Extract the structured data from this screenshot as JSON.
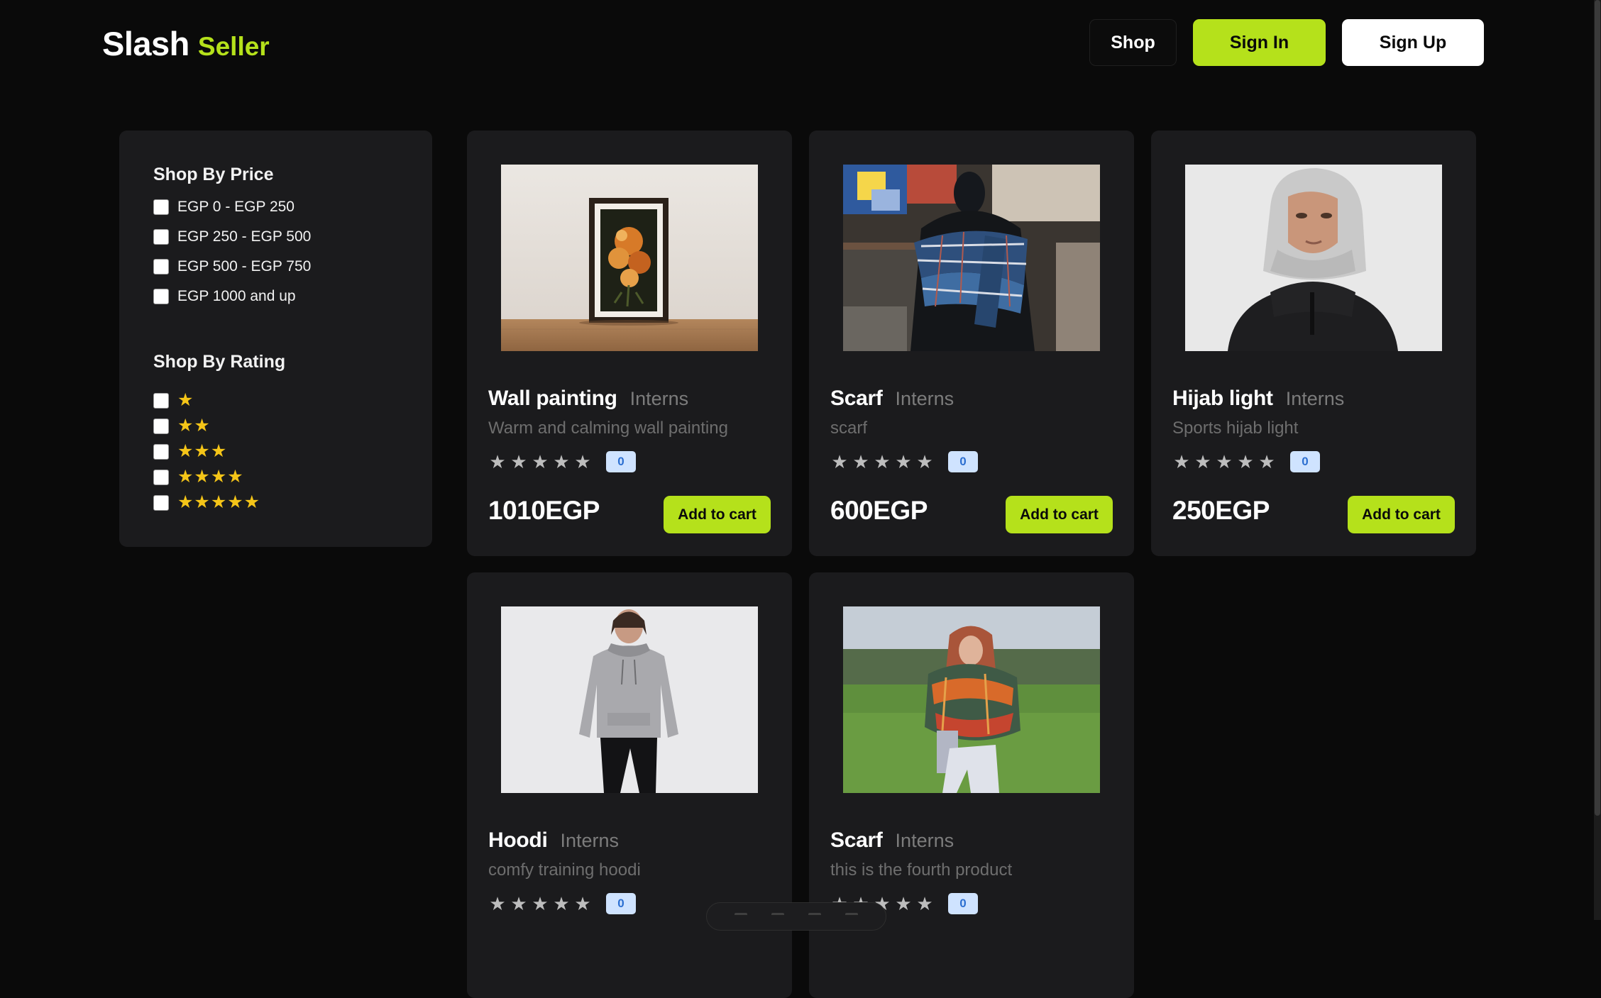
{
  "header": {
    "logo_main": "Slash",
    "logo_accent": "Seller",
    "nav": {
      "shop": "Shop",
      "sign_in": "Sign In",
      "sign_up": "Sign Up"
    }
  },
  "filters": {
    "price_title": "Shop By Price",
    "price_options": [
      "EGP 0 - EGP 250",
      "EGP 250 - EGP 500",
      "EGP 500 - EGP 750",
      "EGP 1000 and up"
    ],
    "rating_title": "Shop By Rating",
    "rating_options": [
      "★",
      "★★",
      "★★★",
      "★★★★",
      "★★★★★"
    ]
  },
  "products": [
    {
      "name": "Wall painting",
      "seller": "Interns",
      "description": "Warm and calming wall painting",
      "rating_count": "0",
      "price": "1010EGP",
      "cart_label": "Add to cart"
    },
    {
      "name": "Scarf",
      "seller": "Interns",
      "description": "scarf",
      "rating_count": "0",
      "price": "600EGP",
      "cart_label": "Add to cart"
    },
    {
      "name": "Hijab light",
      "seller": "Interns",
      "description": "Sports hijab light",
      "rating_count": "0",
      "price": "250EGP",
      "cart_label": "Add to cart"
    },
    {
      "name": "Hoodi",
      "seller": "Interns",
      "description": "comfy training hoodi",
      "rating_count": "0",
      "price": "",
      "cart_label": ""
    },
    {
      "name": "Scarf",
      "seller": "Interns",
      "description": "this is the fourth product",
      "rating_count": "0",
      "price": "",
      "cart_label": ""
    }
  ],
  "colors": {
    "accent": "#b5e11b",
    "background": "#0a0a0a",
    "card": "#1b1b1d",
    "star": "#f5c518"
  },
  "icons": {
    "rating_star": "star-icon"
  }
}
